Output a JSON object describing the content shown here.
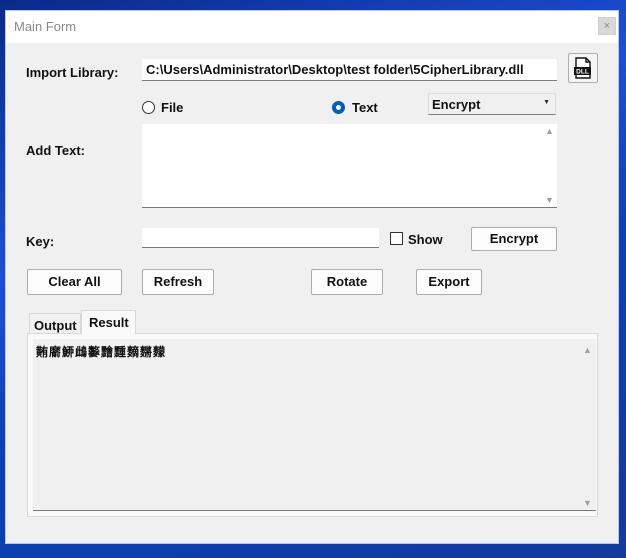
{
  "window": {
    "title": "Main Form",
    "close_glyph": "×"
  },
  "import": {
    "label": "Import Library:",
    "path": "C:\\Users\\Administrator\\Desktop\\test folder\\5CipherLibrary.dll",
    "button_icon": "dll-file-icon",
    "icon_text": "DLL"
  },
  "mode": {
    "file_label": "File",
    "text_label": "Text",
    "selected": "Text"
  },
  "operation": {
    "selected": "Encrypt"
  },
  "add_text": {
    "label": "Add Text:",
    "value": ""
  },
  "key": {
    "label": "Key:",
    "value": "",
    "show_label": "Show",
    "show_checked": false,
    "action_label": "Encrypt"
  },
  "buttons": {
    "clear_all": "Clear All",
    "refresh": "Refresh",
    "rotate": "Rotate",
    "export": "Export"
  },
  "tabs": [
    {
      "label": "Output"
    },
    {
      "label": "Result"
    }
  ],
  "active_tab": "Result",
  "result_text": "䵋䵉䱖䳄䵅䵳䵯䵂䵁䵆"
}
